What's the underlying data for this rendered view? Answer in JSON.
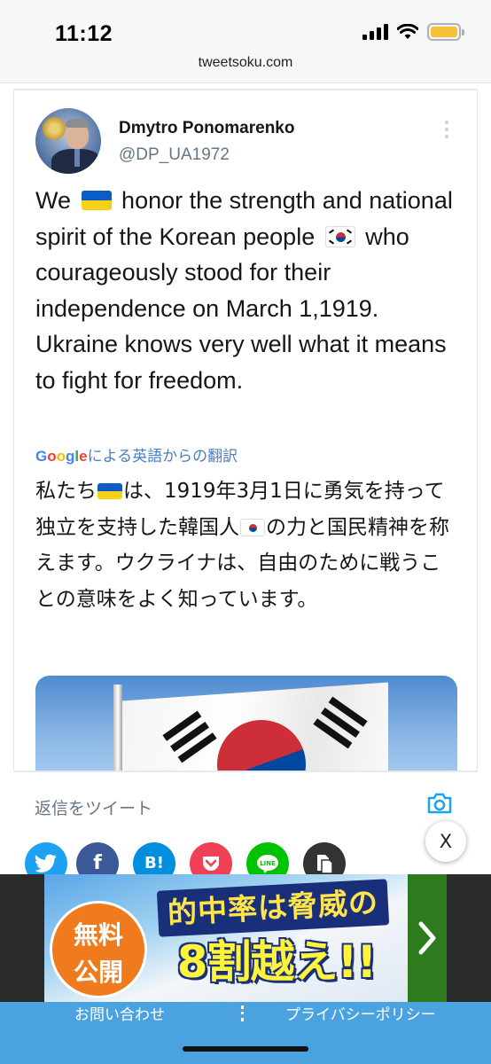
{
  "status_bar": {
    "time": "11:12"
  },
  "browser": {
    "url": "tweetsoku.com"
  },
  "tweet": {
    "author_name": "Dmytro Ponomarenko",
    "author_handle": "@DP_UA1972",
    "text_parts": [
      "We",
      "honor the strength and national spirit of the Korean people",
      "who courageously stood for their independence on March 1,1919. Ukraine knows very well what it means to fight for freedom."
    ],
    "translation_label_google": "Google",
    "translation_label_rest": "による英語からの翻訳",
    "translated_parts": [
      "私たち",
      "は、1919年3月1日に勇気を持って独立を支持した韓国人",
      "の力と国民精神を称えます。ウクライナは、自由のために戦うことの意味をよく知っています。"
    ]
  },
  "reply": {
    "placeholder": "返信をツイート"
  },
  "share_buttons": [
    {
      "name": "twitter",
      "label": "",
      "color": "#1da1f2"
    },
    {
      "name": "facebook",
      "label": "f",
      "color": "#3b5998"
    },
    {
      "name": "hatena",
      "label": "B!",
      "color": "#008fde"
    },
    {
      "name": "pocket",
      "label": "",
      "color": "#ef4056"
    },
    {
      "name": "line",
      "label": "",
      "color": "#00c300"
    },
    {
      "name": "copy",
      "label": "",
      "color": "#333333"
    }
  ],
  "close_button": {
    "label": "X"
  },
  "ad": {
    "circle_line1": "無料",
    "circle_line2": "公開",
    "headline": "的中率は脅威の",
    "big_text": "8割越え!!"
  },
  "footer": {
    "contact": "お問い合わせ",
    "privacy": "プライバシーポリシー"
  },
  "colors": {
    "accent_blue": "#1da1f2",
    "footer_blue": "#4aa3df",
    "ad_orange": "#f07a1e",
    "ua_blue": "#0a5cc7",
    "ua_yellow": "#f7d117"
  }
}
